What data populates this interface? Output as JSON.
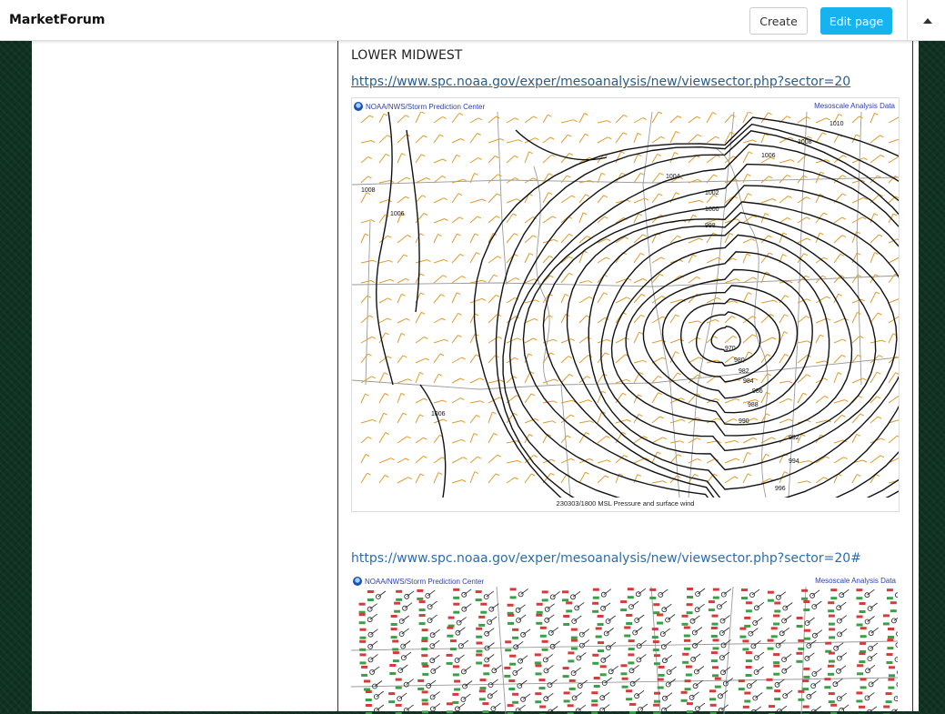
{
  "header": {
    "brand": "MarketForum",
    "create_label": "Create",
    "edit_label": "Edit page"
  },
  "post": {
    "section_title": "LOWER MIDWEST",
    "link1": "https://www.spc.noaa.gov/exper/mesoanalysis/new/viewsector.php?sector=20",
    "link2": "https://www.spc.noaa.gov/exper/mesoanalysis/new/viewsector.php?sector=20#"
  },
  "map1": {
    "source": "NOAA/NWS/Storm Prediction Center",
    "badge": "Mesoscale Analysis Data",
    "caption": "230303/1800 MSL Pressure and surface wind",
    "isobar_labels": [
      "1010",
      "1008",
      "1006",
      "1004",
      "1002",
      "1000",
      "998",
      "1008",
      "1006",
      "970",
      "980",
      "982",
      "984",
      "986",
      "988",
      "990",
      "992",
      "994",
      "996",
      "1006"
    ]
  },
  "map2": {
    "source": "NOAA/NWS/Storm Prediction Center",
    "badge": "Mesoscale Analysis Data"
  },
  "colors": {
    "accent": "#16b3ef",
    "link": "#2a5c8a",
    "barbs": "#e09a2a",
    "isobars": "#111111"
  }
}
